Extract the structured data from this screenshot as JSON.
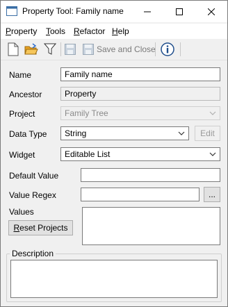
{
  "window": {
    "title": "Property Tool: Family name",
    "controls": {
      "minimize": "minimize",
      "maximize": "maximize",
      "close": "close"
    }
  },
  "menubar": {
    "items": [
      {
        "label_first": "P",
        "label_rest": "roperty"
      },
      {
        "label_first": "T",
        "label_rest": "ools"
      },
      {
        "label_first": "R",
        "label_rest": "efactor"
      },
      {
        "label_first": "H",
        "label_rest": "elp"
      }
    ]
  },
  "toolbar": {
    "icons": [
      "new-document-icon",
      "open-folder-icon",
      "filter-icon",
      "save-icon",
      "save-and-close-icon",
      "info-icon"
    ],
    "save_and_close_label": "Save and Close"
  },
  "form": {
    "name": {
      "label": "Name",
      "value": "Family name"
    },
    "ancestor": {
      "label": "Ancestor",
      "value": "Property"
    },
    "project": {
      "label": "Project",
      "value": "Family Tree"
    },
    "data_type": {
      "label": "Data Type",
      "value": "String",
      "edit_label": "Edit"
    },
    "widget": {
      "label": "Widget",
      "value": "Editable List"
    },
    "default_value": {
      "label": "Default Value",
      "value": ""
    },
    "value_regex": {
      "label": "Value Regex",
      "value": "",
      "browse_label": "..."
    },
    "values": {
      "label": "Values"
    },
    "reset_projects": {
      "label_first": "R",
      "label_rest": "eset Projects"
    },
    "description": {
      "label": "Description"
    }
  }
}
